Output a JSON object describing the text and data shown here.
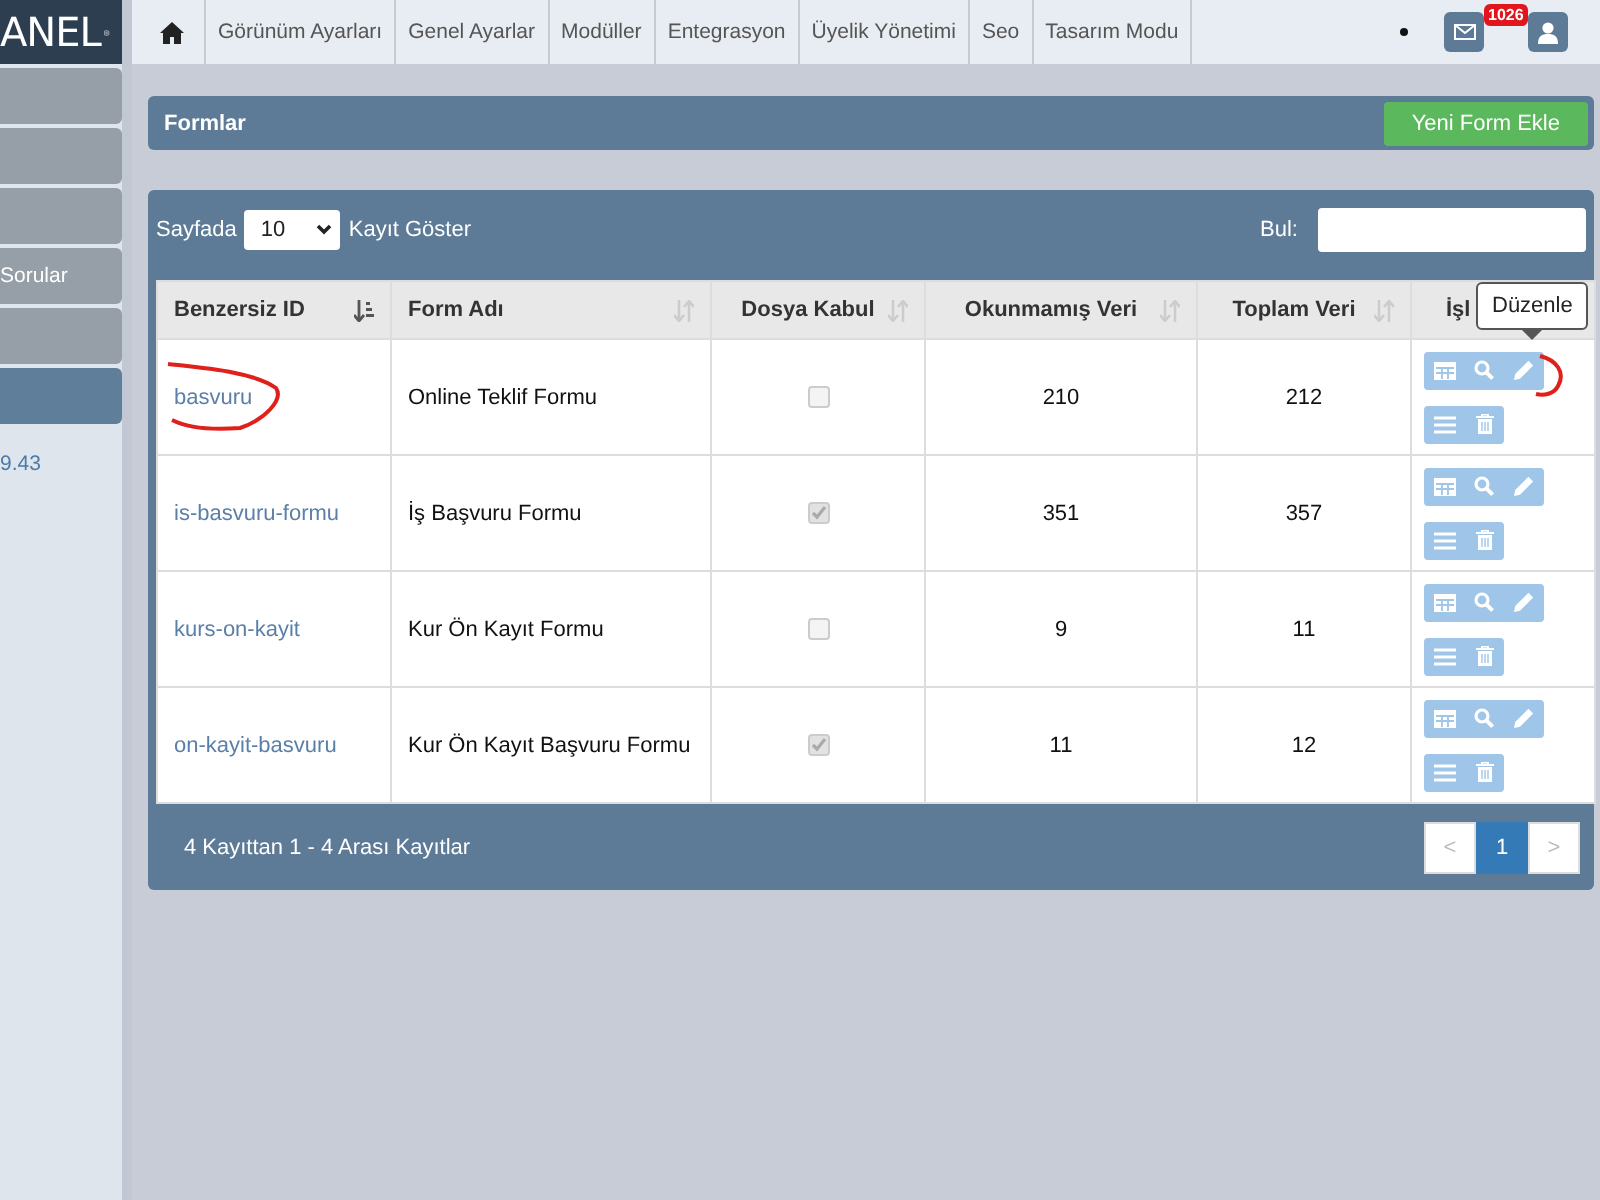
{
  "sidebar": {
    "logo": "ANEL",
    "items": [
      {
        "selected": false
      },
      {
        "selected": false
      },
      {
        "selected": false
      },
      {
        "label": "Sorular",
        "selected": false
      },
      {
        "selected": false
      },
      {
        "selected": true
      }
    ],
    "version": "9.43"
  },
  "top_nav": {
    "tabs": [
      {
        "label": "Görünüm Ayarları"
      },
      {
        "label": "Genel Ayarlar"
      },
      {
        "label": "Modüller"
      },
      {
        "label": "Entegrasyon"
      },
      {
        "label": "Üyelik Yönetimi"
      },
      {
        "label": "Seo"
      },
      {
        "label": "Tasarım Modu"
      }
    ],
    "message_count": "1026"
  },
  "page_header": {
    "title": "Formlar",
    "button": "Yeni Form Ekle"
  },
  "table_controls": {
    "before": "Sayfada",
    "page_size": "10",
    "after": "Kayıt Göster",
    "search_label": "Bul:"
  },
  "table": {
    "columns": [
      {
        "label": "Benzersiz ID",
        "sorted": true
      },
      {
        "label": "Form Adı",
        "sorted": false
      },
      {
        "label": "Dosya Kabul",
        "sorted": false
      },
      {
        "label": "Okunmamış Veri",
        "sorted": false
      },
      {
        "label": "Toplam Veri",
        "sorted": false
      },
      {
        "label": "İşl"
      }
    ],
    "rows": [
      {
        "id": "basvuru",
        "name": "Online Teklif Formu",
        "file_accept": false,
        "unread": "210",
        "total": "212"
      },
      {
        "id": "is-basvuru-formu",
        "name": "İş Başvuru Formu",
        "file_accept": true,
        "unread": "351",
        "total": "357"
      },
      {
        "id": "kurs-on-kayit",
        "name": "Kur Ön Kayıt Formu",
        "file_accept": false,
        "unread": "9",
        "total": "11"
      },
      {
        "id": "on-kayit-basvuru",
        "name": "Kur Ön Kayıt Başvuru Formu",
        "file_accept": true,
        "unread": "11",
        "total": "12"
      }
    ]
  },
  "tooltip": {
    "text": "Düzenle"
  },
  "footer": {
    "info": "4 Kayıttan 1 - 4 Arası Kayıtlar",
    "pagination": [
      {
        "label": "<",
        "selected": false,
        "disabled": true
      },
      {
        "label": "1",
        "selected": true,
        "disabled": false
      },
      {
        "label": ">",
        "selected": false,
        "disabled": true
      }
    ]
  }
}
